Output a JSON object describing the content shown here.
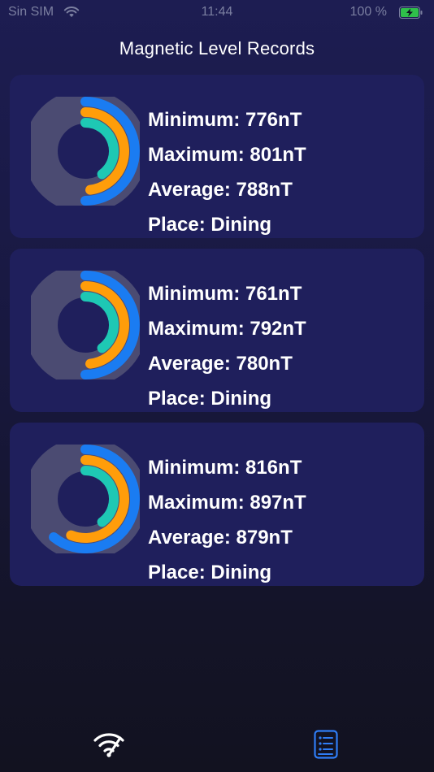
{
  "status_bar": {
    "carrier": "Sin SIM",
    "time": "11:44",
    "battery_percent": "100 %"
  },
  "page_title": "Magnetic Level Records",
  "colors": {
    "outer_ring": "#1a7cf2",
    "middle_ring": "#ff9d0a",
    "inner_ring": "#1ec8b4",
    "background_disc": "#4b4b72",
    "card_background": "#1f1f5c"
  },
  "records": [
    {
      "minimum": "Minimum: 776nT",
      "maximum": "Maximum: 801nT",
      "average": "Average: 788nT",
      "place": "Place: Dining",
      "rings": {
        "outer": 0.5,
        "middle": 0.48,
        "inner": 0.4
      }
    },
    {
      "minimum": "Minimum: 761nT",
      "maximum": "Maximum: 792nT",
      "average": "Average: 780nT",
      "place": "Place: Dining",
      "rings": {
        "outer": 0.5,
        "middle": 0.48,
        "inner": 0.4
      }
    },
    {
      "minimum": "Minimum: 816nT",
      "maximum": "Maximum: 897nT",
      "average": "Average: 879nT",
      "place": "Place: Dining",
      "rings": {
        "outer": 0.61,
        "middle": 0.56,
        "inner": 0.4
      }
    }
  ],
  "tab_bar": {
    "tabs": [
      {
        "icon": "wifi-signal-icon"
      },
      {
        "icon": "list-icon"
      }
    ]
  }
}
